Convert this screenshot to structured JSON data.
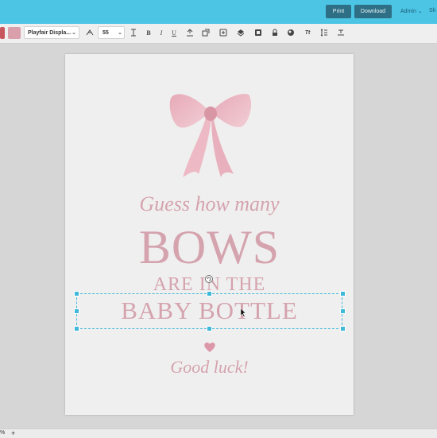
{
  "header": {
    "print_label": "Print",
    "download_label": "Download",
    "admin_label": "Admin",
    "share_label": "Sh"
  },
  "toolbar": {
    "font_family": "Playfair Displa...",
    "font_size": "55",
    "bold": "B",
    "italic": "I",
    "underline": "U",
    "text_case": "Tt"
  },
  "colors": {
    "accent": "#4cc4e4",
    "button": "#2f6f85",
    "swatch_primary": "#c8565f",
    "swatch_secondary": "#d9a0ab",
    "text_pink": "#d4a3ae"
  },
  "design": {
    "line1": "Guess how many",
    "line2": "BOWS",
    "line3": "ARE IN THE",
    "line4": "BABY BOTTLE",
    "line5": "Good luck!"
  },
  "bottombar": {
    "left_glyph": "%",
    "add_label": "+"
  }
}
